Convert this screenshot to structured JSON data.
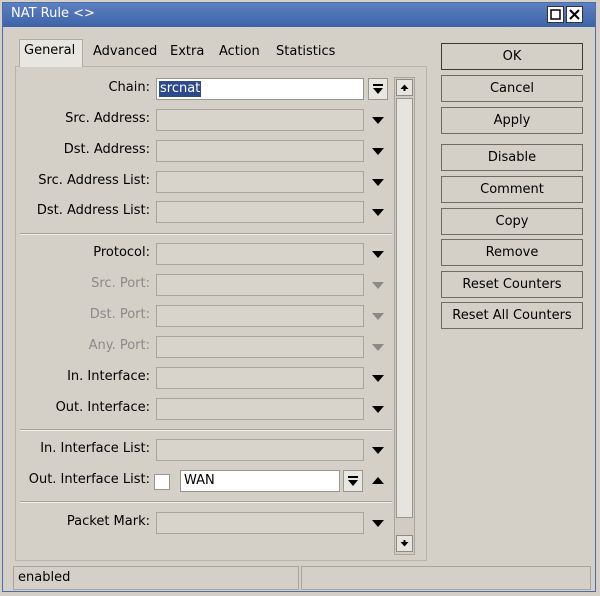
{
  "window": {
    "title": "NAT Rule <>"
  },
  "tabs": [
    "General",
    "Advanced",
    "Extra",
    "Action",
    "Statistics"
  ],
  "fields": {
    "chain": {
      "label": "Chain:",
      "value": "srcnat"
    },
    "src_address": {
      "label": "Src. Address:"
    },
    "dst_address": {
      "label": "Dst. Address:"
    },
    "src_address_list": {
      "label": "Src. Address List:"
    },
    "dst_address_list": {
      "label": "Dst. Address List:"
    },
    "protocol": {
      "label": "Protocol:"
    },
    "src_port": {
      "label": "Src. Port:"
    },
    "dst_port": {
      "label": "Dst. Port:"
    },
    "any_port": {
      "label": "Any. Port:"
    },
    "in_interface": {
      "label": "In. Interface:"
    },
    "out_interface": {
      "label": "Out. Interface:"
    },
    "in_interface_list": {
      "label": "In. Interface List:"
    },
    "out_interface_list": {
      "label": "Out. Interface List:",
      "value": "WAN"
    },
    "packet_mark": {
      "label": "Packet Mark:"
    }
  },
  "buttons": [
    "OK",
    "Cancel",
    "Apply",
    "Disable",
    "Comment",
    "Copy",
    "Remove",
    "Reset Counters",
    "Reset All Counters"
  ],
  "status": {
    "left": "enabled",
    "right": ""
  },
  "icons": [
    "close-icon",
    "maximize-icon",
    "dropdown-arrow-icon",
    "scroll-up-icon",
    "scroll-down-icon"
  ]
}
